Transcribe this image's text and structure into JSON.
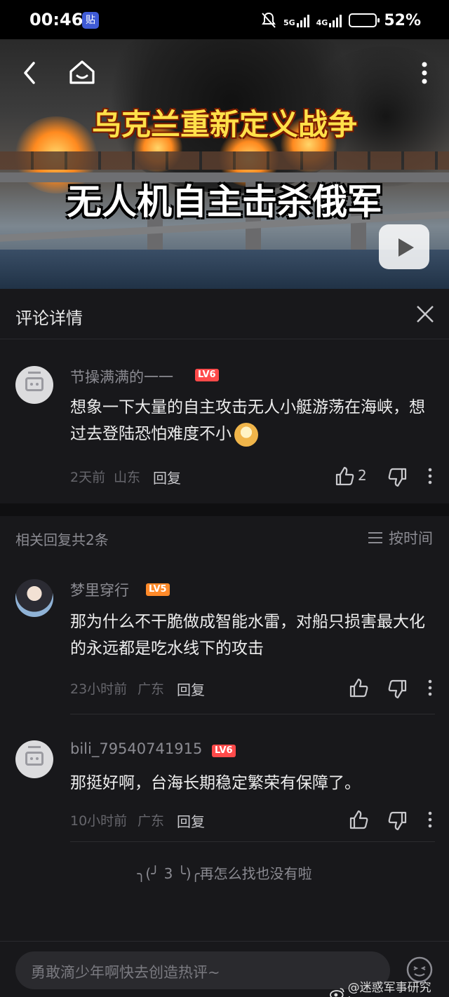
{
  "status_bar": {
    "time": "00:46",
    "app_badge": "贴",
    "net1": "5G",
    "net2": "4G",
    "battery": "52%"
  },
  "video": {
    "title_line1": "乌克兰重新定义战争",
    "title_line2": "无人机自主击杀俄军"
  },
  "panel": {
    "title": "评论详情"
  },
  "main_comment": {
    "user": "节操满满的一一",
    "level": "LV6",
    "text": "想象一下大量的自主攻击无人小艇游荡在海峡，想过去登陆恐怕难度不小",
    "time": "2天前",
    "location": "山东",
    "reply_label": "回复",
    "likes": "2"
  },
  "replies_header": {
    "count_text": "相关回复共2条",
    "sort_label": "按时间"
  },
  "replies": [
    {
      "user": "梦里穿行",
      "level": "LV5",
      "text": "那为什么不干脆做成智能水雷，对船只损害最大化的永远都是吃水线下的攻击",
      "time": "23小时前",
      "location": "广东",
      "reply_label": "回复"
    },
    {
      "user": "bili_79540741915",
      "level": "LV6",
      "text": "那挺好啊，台海长期稳定繁荣有保障了。",
      "time": "10小时前",
      "location": "广东",
      "reply_label": "回复"
    }
  ],
  "end_message": "╮(╯ 3 ╰)╭再怎么找也没有啦",
  "input": {
    "placeholder": "勇敢滴少年啊快去创造热评~"
  },
  "watermark": "@迷惑军事研究bot",
  "colors": {
    "background": "#18181b",
    "level6": "#ff4a4a",
    "level5": "#ff8a2a",
    "title_yellow": "#ffe14a"
  }
}
